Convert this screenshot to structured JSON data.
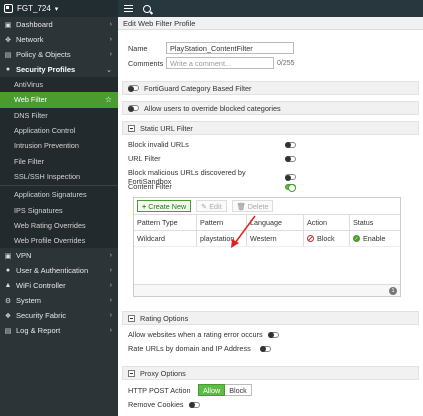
{
  "app": {
    "device_name": "FGT_724"
  },
  "sidebar": {
    "top_items": [
      {
        "label": "Dashboard",
        "icon": "dashboard-icon"
      },
      {
        "label": "Network",
        "icon": "network-icon"
      },
      {
        "label": "Policy & Objects",
        "icon": "policy-icon"
      },
      {
        "label": "Security Profiles",
        "icon": "lock-icon"
      }
    ],
    "security_items": [
      {
        "label": "AntiVirus"
      },
      {
        "label": "Web Filter"
      },
      {
        "label": "DNS Filter"
      },
      {
        "label": "Application Control"
      },
      {
        "label": "Intrusion Prevention"
      },
      {
        "label": "File Filter"
      },
      {
        "label": "SSL/SSH Inspection"
      },
      {
        "label": "Application Signatures"
      },
      {
        "label": "IPS Signatures"
      },
      {
        "label": "Web Rating Overrides"
      },
      {
        "label": "Web Profile Overrides"
      }
    ],
    "bottom_items": [
      {
        "label": "VPN",
        "icon": "vpn-icon"
      },
      {
        "label": "User & Authentication",
        "icon": "user-icon"
      },
      {
        "label": "WiFi Controller",
        "icon": "wifi-icon"
      },
      {
        "label": "System",
        "icon": "gear-icon"
      },
      {
        "label": "Security Fabric",
        "icon": "fabric-icon"
      },
      {
        "label": "Log & Report",
        "icon": "log-icon"
      }
    ]
  },
  "page": {
    "title": "Edit Web Filter Profile",
    "name_label": "Name",
    "name_value": "PlayStation_ContentFilter",
    "comments_label": "Comments",
    "comments_placeholder": "Write a comment...",
    "comments_count": "0/255",
    "fortiguard_label": "FortiGuard Category Based Filter",
    "override_label": "Allow users to override blocked categories",
    "static_url_label": "Static URL Filter",
    "block_invalid": "Block invalid URLs",
    "url_filter": "URL Filter",
    "block_malicious": "Block malicious URLs discovered by FortiSandbox",
    "content_filter": "Content Filter",
    "toolbar": {
      "create_new": "Create New",
      "edit": "Edit",
      "delete": "Delete"
    },
    "table": {
      "headers": [
        "Pattern Type",
        "Pattern",
        "Language",
        "Action",
        "Status"
      ],
      "rows": [
        {
          "pattern_type": "Wildcard",
          "pattern": "playstation",
          "language": "Western",
          "action": "Block",
          "status": "Enable"
        }
      ],
      "count": "1"
    },
    "rating_options_label": "Rating Options",
    "allow_rating_error": "Allow websites when a rating error occurs",
    "rate_urls": "Rate URLs by domain and IP Address",
    "proxy_options_label": "Proxy Options",
    "http_post_label": "HTTP POST Action",
    "http_post_allow": "Allow",
    "http_post_block": "Block",
    "remove_cookies": "Remove Cookies"
  },
  "colors": {
    "accent_green": "#4a9c2f",
    "sidebar_bg": "#2c3438",
    "block_red": "#d02b2b"
  }
}
